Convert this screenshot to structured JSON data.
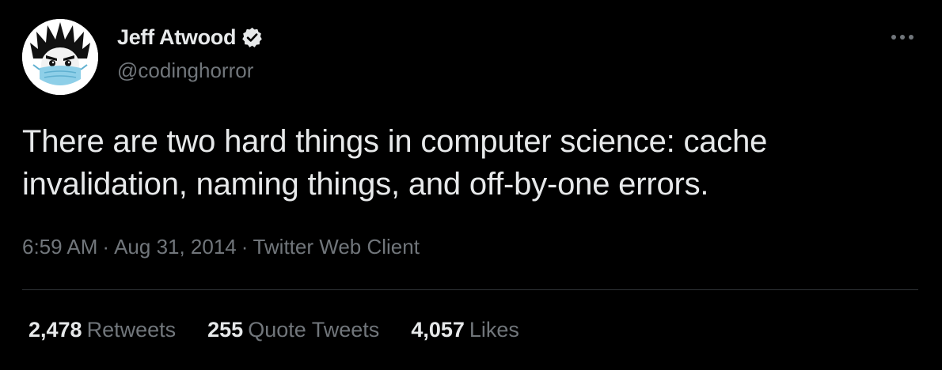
{
  "user": {
    "display_name": "Jeff Atwood",
    "handle": "@codinghorror",
    "verified": true,
    "verified_icon": "verified-badge-icon"
  },
  "menu": {
    "icon": "more-options-icon"
  },
  "tweet": {
    "text": "There are two hard things in computer science: cache invalidation, naming things, and off-by-one errors."
  },
  "meta": {
    "time": "6:59 AM",
    "separator": "·",
    "date": "Aug 31, 2014",
    "client": "Twitter Web Client"
  },
  "stats": {
    "retweets_count": "2,478",
    "retweets_label": "Retweets",
    "quotes_count": "255",
    "quotes_label": "Quote Tweets",
    "likes_count": "4,057",
    "likes_label": "Likes"
  },
  "colors": {
    "background": "#000000",
    "primary_text": "#e7e9ea",
    "secondary_text": "#71767b",
    "divider": "#2f3336"
  }
}
